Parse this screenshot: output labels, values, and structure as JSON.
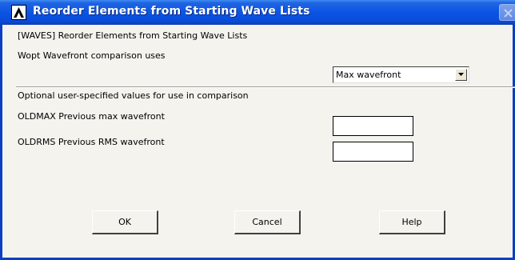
{
  "window": {
    "title": "Reorder Elements from Starting Wave Lists"
  },
  "header": {
    "command": "[WAVES]  Reorder Elements from Starting Wave Lists"
  },
  "wopt": {
    "label": "Wopt  Wavefront comparison uses",
    "selected": "Max wavefront"
  },
  "optional": {
    "section_label": "Optional user-specified values for use in comparison",
    "oldmax_label": "OLDMAX  Previous max wavefront",
    "oldmax_value": "",
    "oldrms_label": "OLDRMS  Previous RMS wavefront",
    "oldrms_value": ""
  },
  "buttons": {
    "ok": "OK",
    "cancel": "Cancel",
    "help": "Help"
  },
  "icons": {
    "title_logo": "ansys-logo-icon",
    "close": "close-icon",
    "dropdown": "chevron-down-icon"
  },
  "colors": {
    "titlebar": "#0b55e3",
    "window_bg": "#f4f3ee"
  }
}
